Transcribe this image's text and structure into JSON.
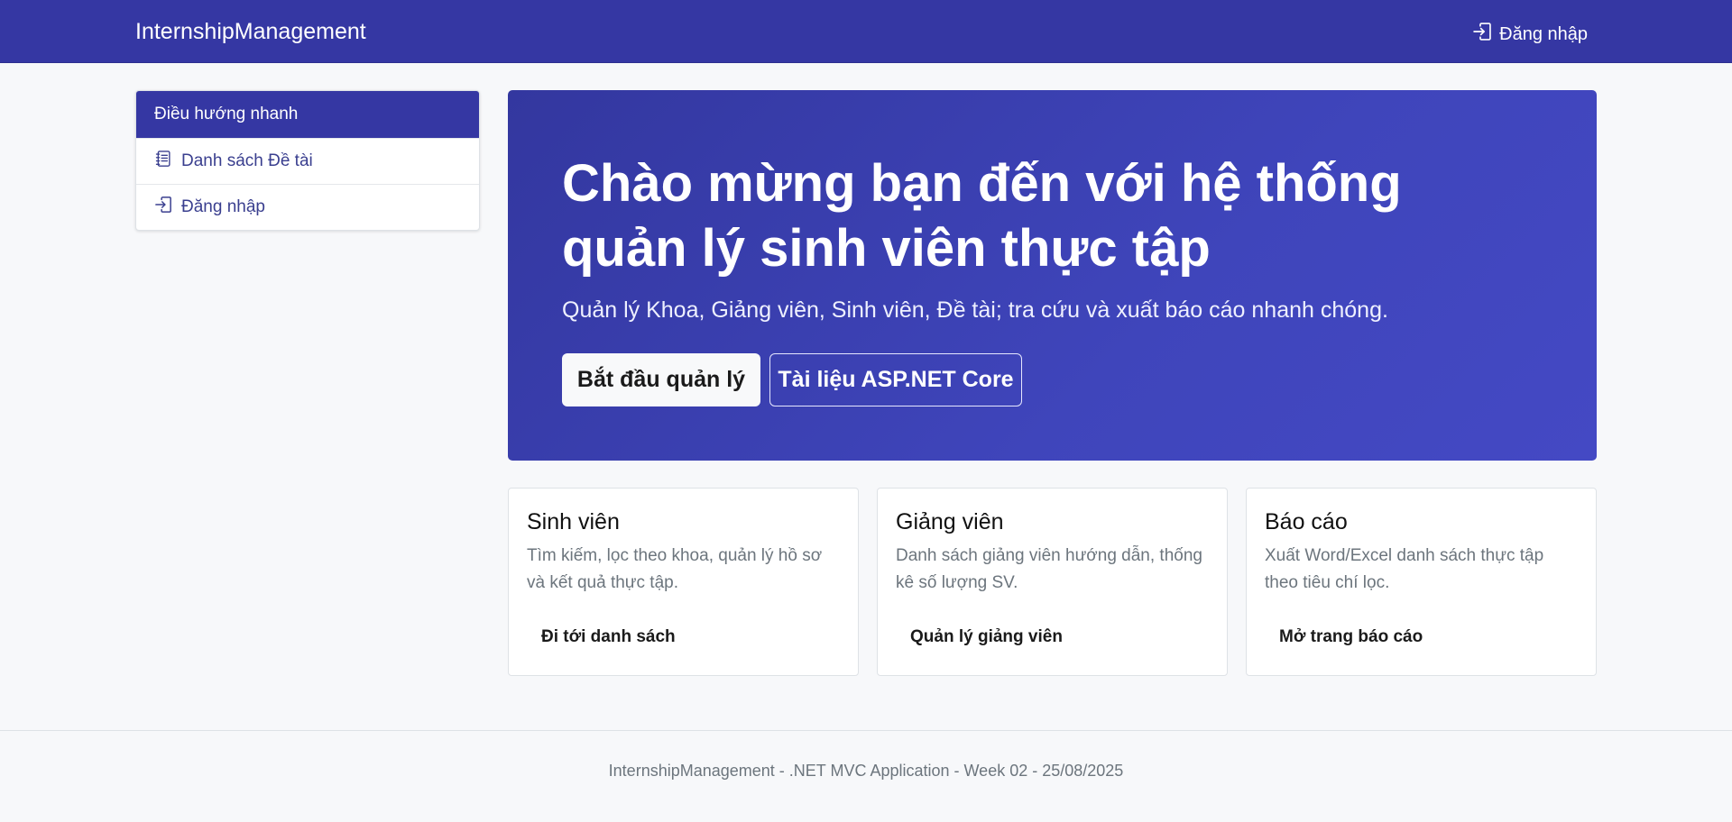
{
  "navbar": {
    "brand": "InternshipManagement",
    "login_label": "Đăng nhập",
    "login_icon": "login-arrow-icon",
    "background": "#3537a3"
  },
  "sidebar": {
    "header": "Điều hướng nhanh",
    "items": [
      {
        "label": "Danh sách Đề tài",
        "icon": "journal-list-icon"
      },
      {
        "label": "Đăng nhập",
        "icon": "login-arrow-icon"
      }
    ]
  },
  "hero": {
    "title": "Chào mừng bạn đến với hệ thống quản lý sinh viên thực tập",
    "subtitle": "Quản lý Khoa, Giảng viên, Sinh viên, Đề tài; tra cứu và xuất báo cáo nhanh chóng.",
    "primary_button": "Bắt đầu quản lý",
    "secondary_button": "Tài liệu ASP.NET Core"
  },
  "cards": [
    {
      "title": "Sinh viên",
      "text": "Tìm kiếm, lọc theo khoa, quản lý hồ sơ và kết quả thực tập.",
      "link": "Đi tới danh sách"
    },
    {
      "title": "Giảng viên",
      "text": "Danh sách giảng viên hướng dẫn, thống kê số lượng SV.",
      "link": "Quản lý giảng viên"
    },
    {
      "title": "Báo cáo",
      "text": "Xuất Word/Excel danh sách thực tập theo tiêu chí lọc.",
      "link": "Mở trang báo cáo"
    }
  ],
  "footer": {
    "text": "InternshipManagement - .NET MVC Application - Week 02 - 25/08/2025"
  }
}
